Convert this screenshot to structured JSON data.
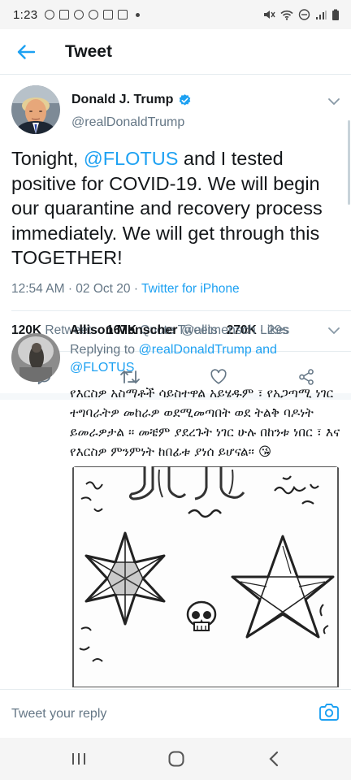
{
  "status_bar": {
    "time": "1:23"
  },
  "header": {
    "back_icon": "arrow-left-icon",
    "title": "Tweet"
  },
  "tweet": {
    "display_name": "Donald J. Trump",
    "handle": "@realDonaldTrump",
    "text_before": "Tonight, ",
    "mention": "@FLOTUS",
    "text_after": " and I tested positive for COVID-19. We will begin our quarantine and recovery process immediately. We will get through this TOGETHER!",
    "time": "12:54 AM",
    "date": "02 Oct 20",
    "source": "Twitter for iPhone",
    "retweets_count": "120K",
    "retweets_label": "Retweets",
    "quote_count": "167K",
    "quote_label": "Quote Tweets",
    "likes_count": "270K",
    "likes_label": "Likes",
    "accent_color": "#1da1f2"
  },
  "reply": {
    "display_name": "Allison Menscher",
    "handle": "@allimensch",
    "age": "29s",
    "replying_prefix": "Replying to ",
    "replying_user1": "@realDonaldTrump",
    "replying_and": " and",
    "replying_user2": "@FLOTUS",
    "text": "የእርስዎ አስማቶች ሳይስተዋል አይሄዱም ፣ የአጋጣሚ ነገር ተግባራትዎ መከራዎ ወደሚመጣበት ወደ ትልቅ ባዶነት ይመራዎታል ፡፡ መቼም ያደረጉት ነገር ሁሉ በከንቱ ነበር ፣ እና የእርስዎ ምንምነት ከበፊቱ ያነሰ ይሆናል፡፡ 😘"
  },
  "compose": {
    "placeholder": "Tweet your reply"
  }
}
